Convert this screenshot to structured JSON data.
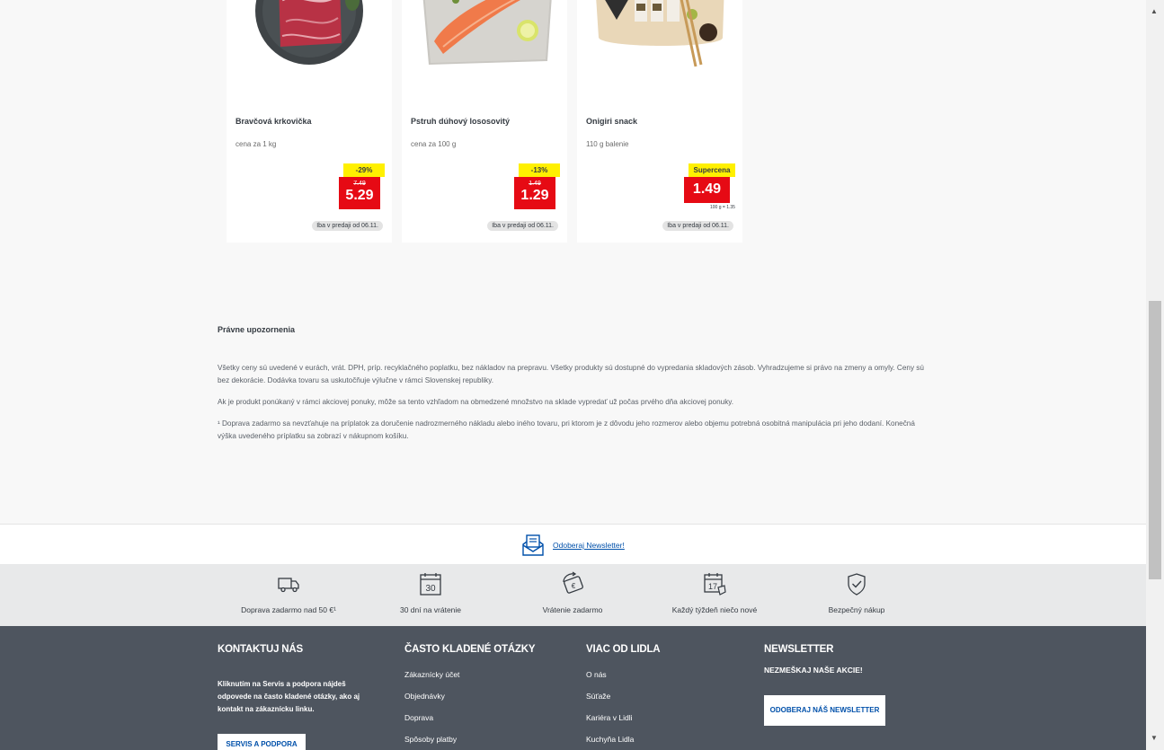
{
  "products": [
    {
      "name": "Bravčová krkovička",
      "unit": "cena za 1 kg",
      "badge": "-29%",
      "old_price": "7.49",
      "price": "5.29",
      "availability": "Iba v predaji od 06.11.",
      "image": "pork-neck-image"
    },
    {
      "name": "Pstruh dúhový lososovitý",
      "unit": "cena za 100 g",
      "badge": "-13%",
      "old_price": "1.49",
      "price": "1.29",
      "availability": "Iba v predaji od 06.11.",
      "image": "trout-fillet-image"
    },
    {
      "name": "Onigiri snack",
      "unit": "110 g balenie",
      "badge": "Supercena",
      "price": "1.49",
      "price_per_unit": "100 g = 1.35",
      "availability": "Iba v predaji od 06.11.",
      "image": "onigiri-image"
    }
  ],
  "legal": {
    "title": "Právne upozornenia",
    "p1": "Všetky ceny sú uvedené v eurách, vrát. DPH, príp. recyklačného poplatku, bez nákladov na prepravu. Všetky produkty sú dostupné do vypredania skladových zásob. Vyhradzujeme si právo na zmeny a omyly. Ceny sú bez dekorácie. Dodávka tovaru sa uskutočňuje výlučne v rámci Slovenskej republiky.",
    "p2": "Ak je produkt ponúkaný v rámci akciovej ponuky, môže sa tento vzhľadom na obmedzené množstvo na sklade vypredať už počas prvého dňa akciovej ponuky.",
    "p3": "¹ Doprava zadarmo sa nevzťahuje na príplatok za doručenie nadrozmerného nákladu alebo iného tovaru, pri ktorom je z dôvodu jeho rozmerov alebo objemu potrebná osobitná manipulácia pri jeho dodaní. Konečná výška uvedeného príplatku sa zobrazí v nákupnom košíku."
  },
  "newsletter_strip": {
    "link": "Odoberaj Newsletter!",
    "icon": "envelope-icon"
  },
  "benefits": [
    {
      "label": "Doprava zadarmo nad 50 €¹",
      "icon": "truck-icon"
    },
    {
      "label": "30 dní na vrátenie",
      "icon": "calendar-30-icon",
      "icon_text": "30"
    },
    {
      "label": "Vrátenie zadarmo",
      "icon": "refund-icon",
      "icon_text": "€"
    },
    {
      "label": "Každý týždeň niečo nové",
      "icon": "calendar-17-icon",
      "icon_text": "17"
    },
    {
      "label": "Bezpečný nákup",
      "icon": "shield-check-icon"
    }
  ],
  "footer": {
    "contact": {
      "title": "KONTAKTUJ NÁS",
      "desc": "Kliknutím na Servis a podpora nájdeš odpovede na často kladené otázky, ako aj kontakt na zákaznícku linku.",
      "button": "SERVIS A PODPORA"
    },
    "faq": {
      "title": "ČASTO KLADENÉ OTÁZKY",
      "links": [
        "Zákaznícky účet",
        "Objednávky",
        "Doprava",
        "Spôsoby platby"
      ]
    },
    "more": {
      "title": "VIAC OD LIDLA",
      "links": [
        "O nás",
        "Súťaže",
        "Kariéra v Lidli",
        "Kuchyňa Lidla"
      ]
    },
    "newsletter": {
      "title": "NEWSLETTER",
      "subtitle": "NEZMEŠKAJ NAŠE AKCIE!",
      "button": "ODOBERAJ NÁŠ NEWSLETTER"
    }
  },
  "colors": {
    "accent_red": "#e60a14",
    "badge_yellow": "#fff000",
    "link_blue": "#0050aa",
    "footer_bg": "#4e555f"
  }
}
